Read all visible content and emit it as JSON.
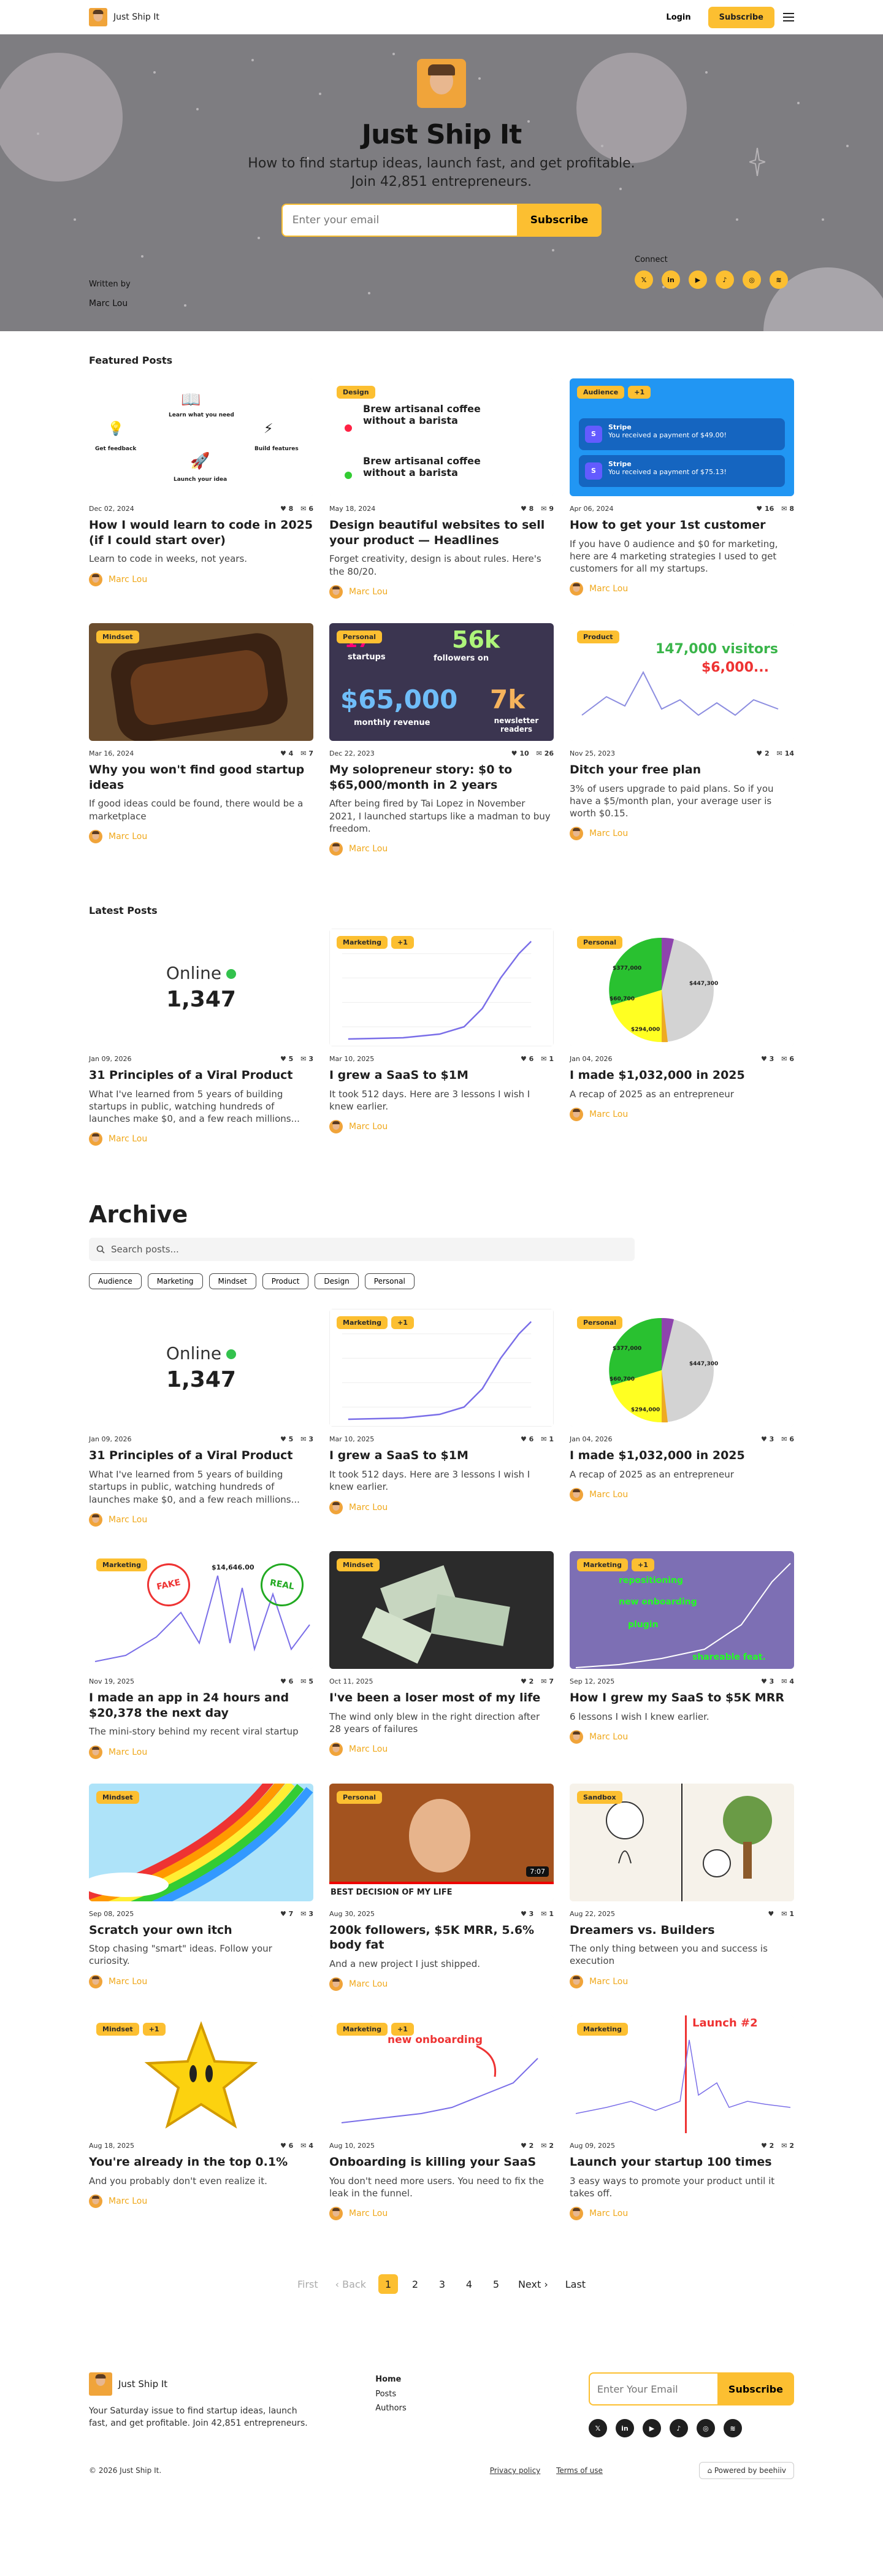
{
  "nav": {
    "brand": "Just Ship It",
    "login": "Login",
    "subscribe": "Subscribe"
  },
  "hero": {
    "title": "Just Ship It",
    "subtitle": "How to find startup ideas, launch fast, and get profitable.",
    "subtitle2": "Join 42,851 entrepreneurs.",
    "email_placeholder": "Enter your email",
    "subscribe": "Subscribe",
    "written_by": "Written by",
    "author": "Marc Lou",
    "connect": "Connect"
  },
  "featured": {
    "title": "Featured Posts",
    "posts": [
      {
        "date": "Dec 02, 2024",
        "likes": "8",
        "comments": "6",
        "title": "How I would learn to code in 2025 (if I could start over)",
        "desc": "Learn to code in weeks, not years.",
        "author": "Marc Lou",
        "tags": [],
        "art": "cycle",
        "art_labels": [
          "Learn what you need",
          "Build features",
          "Launch your idea",
          "Get feedback"
        ]
      },
      {
        "date": "May 18, 2024",
        "likes": "8",
        "comments": "9",
        "title": "Design beautiful websites to sell your product — Headlines",
        "desc": "Forget creativity, design is about rules. Here's the 80/20.",
        "author": "Marc Lou",
        "tags": [
          "Design"
        ],
        "art": "type",
        "art_labels": [
          "Brew artisanal coffee without a barista",
          "Brew artisanal coffee without a barista"
        ]
      },
      {
        "date": "Apr 06, 2024",
        "likes": "16",
        "comments": "8",
        "title": "How to get your 1st customer",
        "desc": "If you have 0 audience and $0 for marketing, here are 4 marketing strategies I used to get customers for all my startups.",
        "author": "Marc Lou",
        "tags": [
          "Audience",
          "+1"
        ],
        "art": "stripe",
        "art_labels": [
          "Stripe",
          "You received a payment of $49.00!",
          "Stripe",
          "You received a payment of $75.13!"
        ]
      },
      {
        "date": "Mar 16, 2024",
        "likes": "4",
        "comments": "7",
        "title": "Why you won't find good startup ideas",
        "desc": "If good ideas could be found, there would be a marketplace",
        "author": "Marc Lou",
        "tags": [
          "Mindset"
        ],
        "art": "bread"
      },
      {
        "date": "Dec 22, 2023",
        "likes": "10",
        "comments": "26",
        "title": "My solopreneur story: $0 to $65,000/month in 2 years",
        "desc": "After being fired by Tai Lopez in November 2021, I launched startups like a madman to buy freedom.",
        "author": "Marc Lou",
        "tags": [
          "Personal"
        ],
        "art": "stats",
        "art_labels": [
          "17",
          "startups",
          "56k",
          "followers on",
          "$65,000",
          "monthly revenue",
          "7k",
          "newsletter readers"
        ]
      },
      {
        "date": "Nov 25, 2023",
        "likes": "2",
        "comments": "14",
        "title": "Ditch your free plan",
        "desc": "3% of users upgrade to paid plans. So if you have a $5/month plan, your average user is worth $0.15.",
        "author": "Marc Lou",
        "tags": [
          "Product"
        ],
        "art": "visitors",
        "art_labels": [
          "147,000 visitors",
          "$6,000..."
        ]
      }
    ]
  },
  "latest": {
    "title": "Latest Posts",
    "posts": [
      {
        "date": "Jan 09, 2026",
        "likes": "5",
        "comments": "3",
        "title": "31 Principles of a Viral Product",
        "desc": "What I've learned from 5 years of building startups in public, watching hundreds of launches make $0, and a few reach millions...",
        "author": "Marc Lou",
        "tags": [],
        "art": "online",
        "art_labels": [
          "Online",
          "1,347"
        ]
      },
      {
        "date": "Mar 10, 2025",
        "likes": "6",
        "comments": "1",
        "title": "I grew a SaaS to $1M",
        "desc": "It took 512 days. Here are 3 lessons I wish I knew earlier.",
        "author": "Marc Lou",
        "tags": [
          "Marketing",
          "+1"
        ],
        "art": "growth"
      },
      {
        "date": "Jan 04, 2026",
        "likes": "3",
        "comments": "6",
        "title": "I made $1,032,000 in 2025",
        "desc": "A recap of 2025 as an entrepreneur",
        "author": "Marc Lou",
        "tags": [
          "Personal"
        ],
        "art": "pie",
        "art_labels": [
          "$447,300",
          "$377,000",
          "$294,000",
          "$60,700"
        ]
      }
    ]
  },
  "archive": {
    "title": "Archive",
    "search_placeholder": "Search posts...",
    "filters": [
      "Audience",
      "Marketing",
      "Mindset",
      "Product",
      "Design",
      "Personal"
    ],
    "posts": [
      {
        "date": "Jan 09, 2026",
        "likes": "5",
        "comments": "3",
        "title": "31 Principles of a Viral Product",
        "desc": "What I've learned from 5 years of building startups in public, watching hundreds of launches make $0, and a few reach millions...",
        "author": "Marc Lou",
        "tags": [],
        "art": "online",
        "art_labels": [
          "Online",
          "1,347"
        ]
      },
      {
        "date": "Mar 10, 2025",
        "likes": "6",
        "comments": "1",
        "title": "I grew a SaaS to $1M",
        "desc": "It took 512 days. Here are 3 lessons I wish I knew earlier.",
        "author": "Marc Lou",
        "tags": [
          "Marketing",
          "+1"
        ],
        "art": "growth"
      },
      {
        "date": "Jan 04, 2026",
        "likes": "3",
        "comments": "6",
        "title": "I made $1,032,000 in 2025",
        "desc": "A recap of 2025 as an entrepreneur",
        "author": "Marc Lou",
        "tags": [
          "Personal"
        ],
        "art": "pie",
        "art_labels": [
          "$447,300",
          "$377,000",
          "$294,000",
          "$60,700"
        ]
      },
      {
        "date": "Nov 19, 2025",
        "likes": "6",
        "comments": "5",
        "title": "I made an app in 24 hours and $20,378 the next day",
        "desc": "The mini-story behind my recent viral startup",
        "author": "Marc Lou",
        "tags": [
          "Marketing"
        ],
        "art": "fake",
        "art_labels": [
          "FAKE",
          "$14,646.00",
          "REAL"
        ]
      },
      {
        "date": "Oct 11, 2025",
        "likes": "2",
        "comments": "7",
        "title": "I've been a loser most of my life",
        "desc": "The wind only blew in the right direction after 28 years of failures",
        "author": "Marc Lou",
        "tags": [
          "Mindset"
        ],
        "art": "money"
      },
      {
        "date": "Sep 12, 2025",
        "likes": "3",
        "comments": "4",
        "title": "How I grew my SaaS to $5K MRR",
        "desc": "6 lessons I wish I knew earlier.",
        "author": "Marc Lou",
        "tags": [
          "Marketing",
          "+1"
        ],
        "art": "saas",
        "art_labels": [
          "repositioning",
          "new onboarding",
          "plugin",
          "shareable feat."
        ]
      },
      {
        "date": "Sep 08, 2025",
        "likes": "7",
        "comments": "3",
        "title": "Scratch your own itch",
        "desc": "Stop chasing \"smart\" ideas. Follow your curiosity.",
        "author": "Marc Lou",
        "tags": [
          "Mindset"
        ],
        "art": "rainbow"
      },
      {
        "date": "Aug 30, 2025",
        "likes": "3",
        "comments": "1",
        "title": "200k followers, $5K MRR, 5.6% body fat",
        "desc": "And a new project I just shipped.",
        "author": "Marc Lou",
        "tags": [
          "Personal"
        ],
        "art": "video",
        "art_labels": [
          "BEST DECISION OF MY LIFE",
          "7:07"
        ]
      },
      {
        "date": "Aug 22, 2025",
        "likes": "",
        "comments": "1",
        "title": "Dreamers vs. Builders",
        "desc": "The only thing between you and success is execution",
        "author": "Marc Lou",
        "tags": [
          "Sandbox"
        ],
        "art": "sketch"
      },
      {
        "date": "Aug 18, 2025",
        "likes": "6",
        "comments": "4",
        "title": "You're already in the top 0.1%",
        "desc": "And you probably don't even realize it.",
        "author": "Marc Lou",
        "tags": [
          "Mindset",
          "+1"
        ],
        "art": "star"
      },
      {
        "date": "Aug 10, 2025",
        "likes": "2",
        "comments": "2",
        "title": "Onboarding is killing your SaaS",
        "desc": "You don't need more users. You need to fix the leak in the funnel.",
        "author": "Marc Lou",
        "tags": [
          "Marketing",
          "+1"
        ],
        "art": "onboard",
        "art_labels": [
          "new onboarding"
        ]
      },
      {
        "date": "Aug 09, 2025",
        "likes": "2",
        "comments": "2",
        "title": "Launch your startup 100 times",
        "desc": "3 easy ways to promote your product until it takes off.",
        "author": "Marc Lou",
        "tags": [
          "Marketing"
        ],
        "art": "launch",
        "art_labels": [
          "Launch #2"
        ]
      }
    ]
  },
  "pagination": {
    "first": "First",
    "back": "Back",
    "pages": [
      "1",
      "2",
      "3",
      "4",
      "5"
    ],
    "next": "Next",
    "last": "Last"
  },
  "footer": {
    "brand": "Just Ship It",
    "desc": "Your Saturday issue to find startup ideas, launch fast, and get profitable. Join 42,851 entrepreneurs.",
    "links_title": "Home",
    "links": [
      "Posts",
      "Authors"
    ],
    "email_placeholder": "Enter Your Email",
    "subscribe": "Subscribe",
    "copyright": "© 2026 Just Ship It.",
    "privacy": "Privacy policy",
    "terms": "Terms of use",
    "powered": "Powered by beehiiv"
  },
  "socials": [
    "x-icon",
    "linkedin-icon",
    "youtube-icon",
    "tiktok-icon",
    "instagram-icon",
    "rss-icon"
  ],
  "colors": {
    "accent": "#fcbf31",
    "hero_bg": "#7e7d81",
    "author_link": "#f0a81b"
  }
}
